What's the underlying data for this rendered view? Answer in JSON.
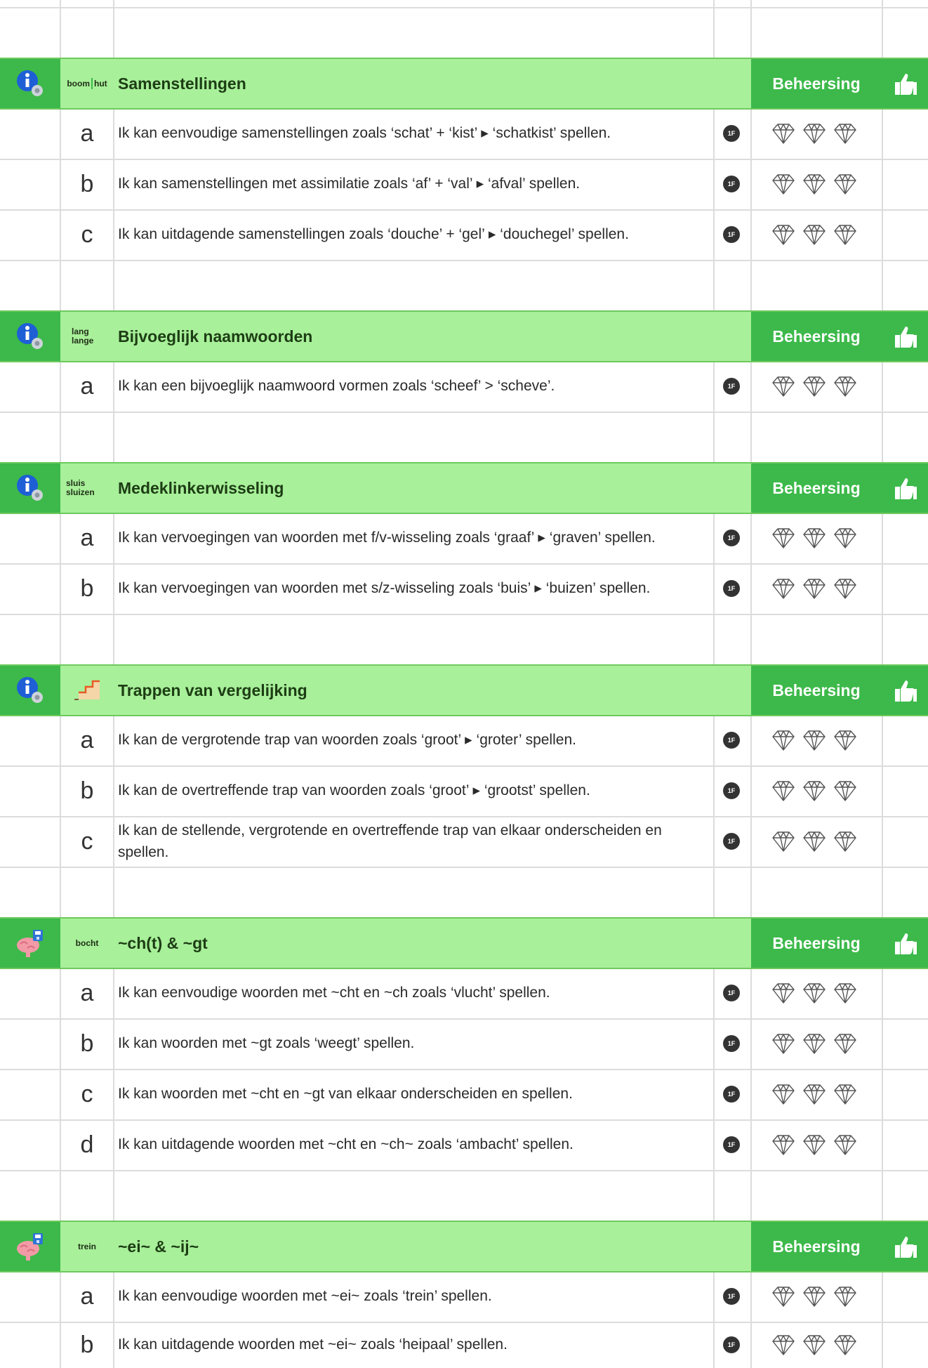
{
  "mastery_label": "Beheersing",
  "level_tag": "1F",
  "colors": {
    "header_bg": "#a8f09a",
    "accent": "#3cb94a",
    "grid": "#dcdcdc"
  },
  "sections": [
    {
      "title": "Samenstellingen",
      "icon": "info-settings-icon",
      "mini_label": [
        "boom",
        "hut"
      ],
      "items": [
        {
          "letter": "a",
          "text": "Ik kan eenvoudige samenstellingen zoals ‘schat’ + ‘kist’ ▸ ‘schatkist’ spellen."
        },
        {
          "letter": "b",
          "text": "Ik kan samenstellingen met assimilatie zoals ‘af’ + ‘val’ ▸ ‘afval’ spellen."
        },
        {
          "letter": "c",
          "text": "Ik kan uitdagende samenstellingen zoals ‘douche’ + ‘gel’ ▸ ‘douchegel’ spellen."
        }
      ]
    },
    {
      "title": "Bijvoeglijk naamwoorden",
      "icon": "info-settings-icon",
      "mini_label": [
        "lang",
        "lange"
      ],
      "items": [
        {
          "letter": "a",
          "text": "Ik kan een bijvoeglijk naamwoord vormen zoals ‘scheef’ > ‘scheve’."
        }
      ]
    },
    {
      "title": "Medeklinkerwisseling",
      "icon": "info-settings-icon",
      "mini_label": [
        "sluis",
        "sluizen"
      ],
      "items": [
        {
          "letter": "a",
          "text": "Ik kan vervoegingen van woorden met f/v-wisseling zoals ‘graaf’ ▸ ‘graven’ spellen."
        },
        {
          "letter": "b",
          "text": "Ik kan vervoegingen van woorden met s/z-wisseling zoals ‘buis’ ▸ ‘buizen’ spellen."
        }
      ]
    },
    {
      "title": "Trappen van vergelijking",
      "icon": "info-settings-icon",
      "mini_label": [],
      "items": [
        {
          "letter": "a",
          "text": "Ik kan de vergrotende trap van woorden zoals ‘groot’ ▸ ‘groter’ spellen."
        },
        {
          "letter": "b",
          "text": "Ik kan de overtreffende trap van woorden zoals ‘groot’ ▸ ‘grootst’ spellen."
        },
        {
          "letter": "c",
          "text": "Ik kan de stellende, vergrotende en overtreffende trap van elkaar onderscheiden en spellen."
        }
      ]
    },
    {
      "title": "~ch(t) & ~gt",
      "icon": "brain-memory-icon",
      "mini_label": [
        "bocht"
      ],
      "items": [
        {
          "letter": "a",
          "text": "Ik kan eenvoudige woorden met ~cht en ~ch zoals ‘vlucht’ spellen."
        },
        {
          "letter": "b",
          "text": "Ik kan woorden met ~gt zoals ‘weegt’ spellen."
        },
        {
          "letter": "c",
          "text": "Ik kan woorden met ~cht en ~gt van elkaar onderscheiden en spellen."
        },
        {
          "letter": "d",
          "text": "Ik kan uitdagende woorden met ~cht en ~ch~ zoals ‘ambacht’ spellen."
        }
      ]
    },
    {
      "title": "~ei~ & ~ij~",
      "icon": "brain-memory-icon",
      "mini_label": [
        "trein"
      ],
      "items": [
        {
          "letter": "a",
          "text": "Ik kan eenvoudige woorden met ~ei~ zoals ‘trein’ spellen."
        },
        {
          "letter": "b",
          "text": "Ik kan uitdagende woorden met ~ei~ zoals ‘heipaal’ spellen."
        }
      ]
    }
  ]
}
